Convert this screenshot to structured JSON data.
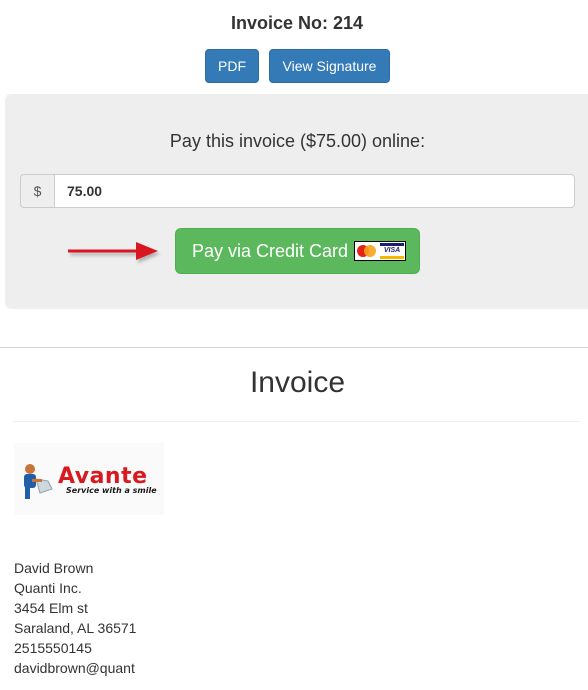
{
  "header": {
    "invoice_number": "Invoice No: 214"
  },
  "actions": {
    "pdf_label": "PDF",
    "view_signature_label": "View Signature"
  },
  "payment": {
    "title": "Pay this invoice ($75.00) online:",
    "currency_symbol": "$",
    "amount_value": "75.00",
    "pay_button_label": "Pay via Credit Card",
    "card_icons": [
      "mastercard-icon",
      "visa-icon"
    ],
    "visa_text": "VISA"
  },
  "invoice": {
    "heading": "Invoice",
    "logo": {
      "name": "Avante",
      "tagline": "Service with a smile"
    },
    "customer": {
      "name": "David Brown",
      "company": "Quanti Inc.",
      "street": "3454 Elm st",
      "city_state_zip": "Saraland, AL 36571",
      "phone": "2515550145",
      "email": "davidbrown@quant"
    }
  },
  "colors": {
    "primary_blue": "#337ab7",
    "success_green": "#5cb85c",
    "panel_gray": "#eeeeee",
    "arrow_red": "#d71920"
  }
}
